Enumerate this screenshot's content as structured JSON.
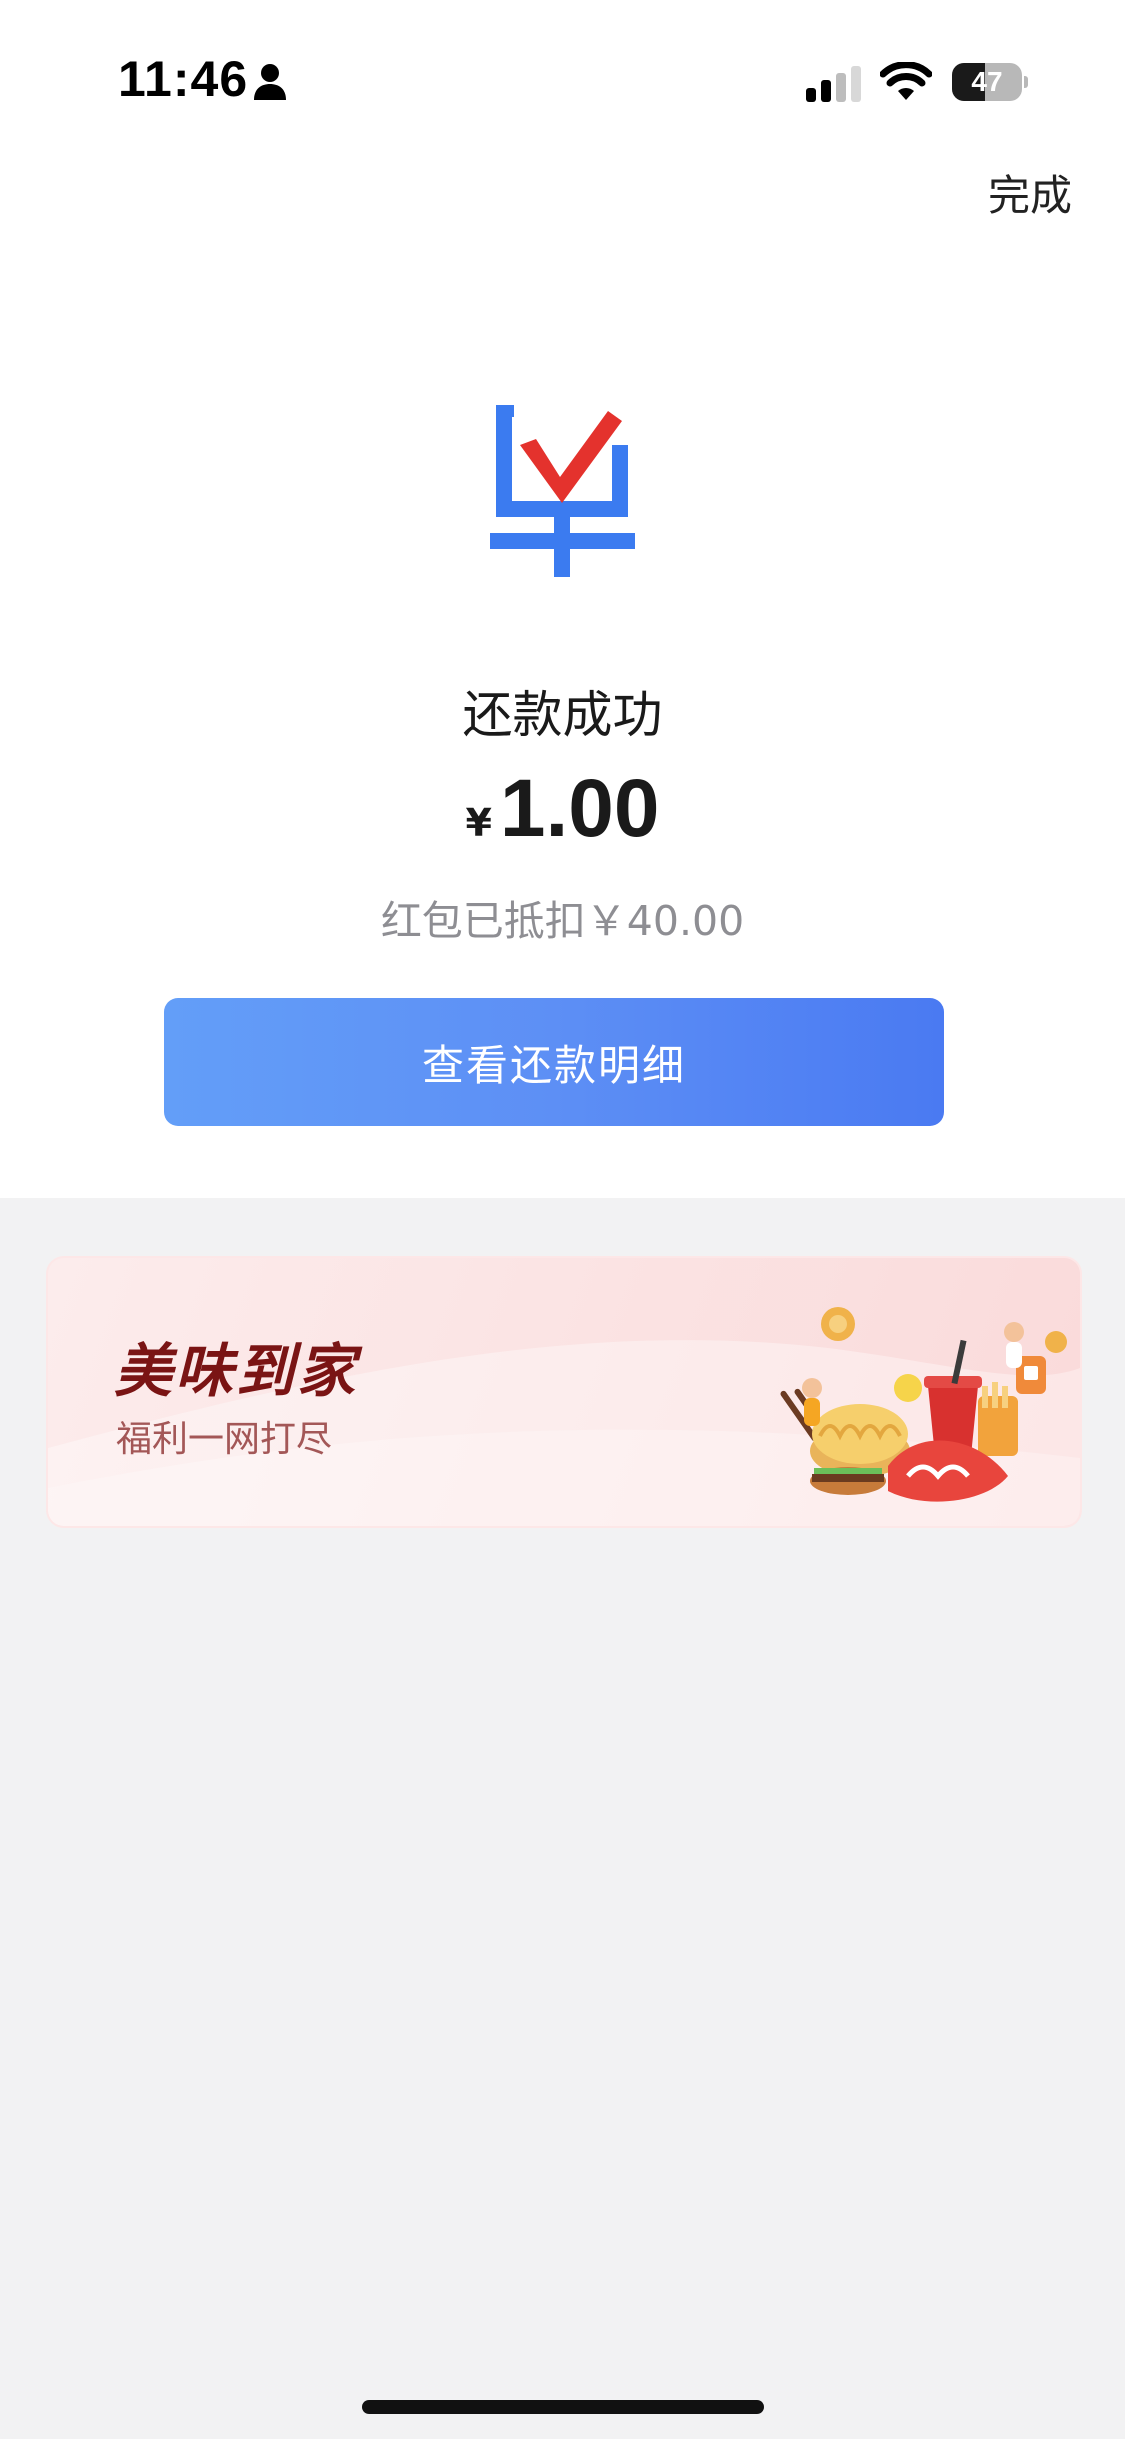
{
  "status_bar": {
    "time": "11:46",
    "battery_level": "47",
    "battery_fraction": 0.47,
    "icons": [
      "person-icon",
      "cellular-signal-icon",
      "wifi-icon",
      "battery-icon"
    ]
  },
  "header": {
    "done_label": "完成"
  },
  "result": {
    "logo_icon": "bill-check-logo",
    "title": "还款成功",
    "currency_symbol": "¥",
    "amount": "1.00",
    "deduction_text": "红包已抵扣￥40.00"
  },
  "actions": {
    "view_details_label": "查看还款明细"
  },
  "promo": {
    "title": "美味到家",
    "subtitle": "福利一网打尽",
    "illustration": "food-illustration"
  },
  "colors": {
    "brand_blue": "#3b7bf0",
    "check_red": "#e4322d",
    "button_gradient_start": "#639ef8",
    "button_gradient_end": "#4a7af2",
    "promo_title": "#7a1414",
    "page_background": "#f2f2f3"
  }
}
